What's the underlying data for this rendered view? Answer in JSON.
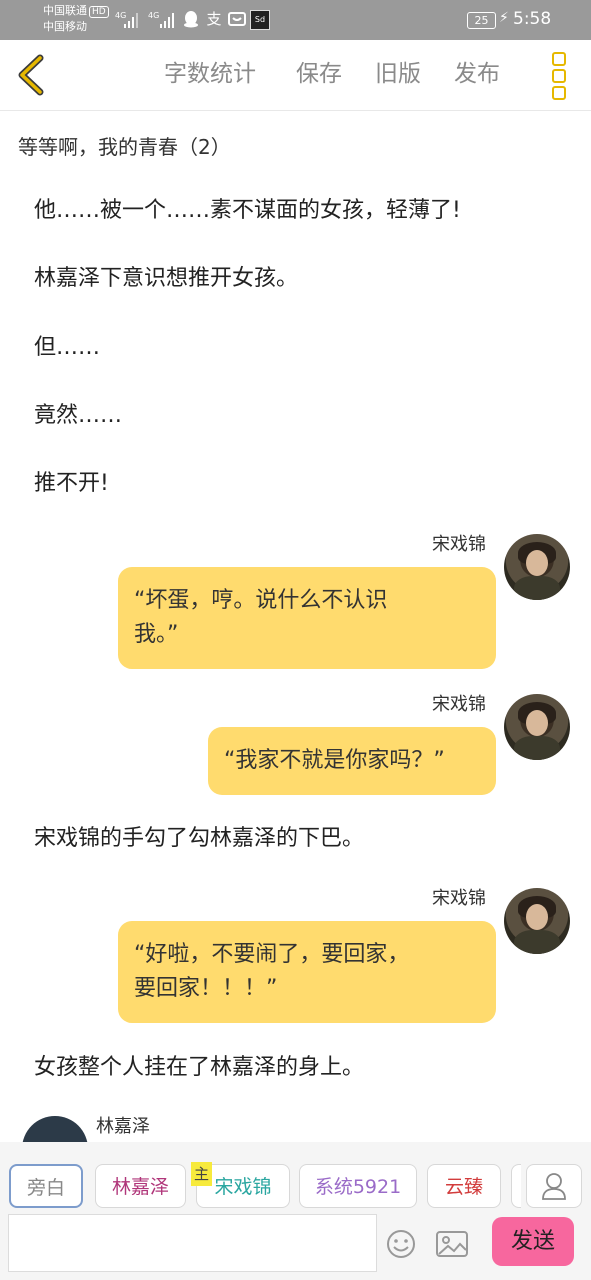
{
  "status_bar": {
    "carrier1": "中国联通",
    "hd": "HD",
    "carrier2": "中国移动",
    "net1": "4G",
    "net2": "4G",
    "battery": "25",
    "time": "5:58"
  },
  "toolbar": {
    "word_count": "字数统计",
    "save": "保存",
    "old_version": "旧版",
    "publish": "发布"
  },
  "chapter_title": "等等啊，我的青春（2）",
  "content": {
    "narration1": "他……被一个……素不谋面的女孩，轻薄了!",
    "narration2": "林嘉泽下意识想推开女孩。",
    "narration3": "但……",
    "narration4": "竟然……",
    "narration5": "推不开!",
    "msg1_speaker": "宋戏锦",
    "msg1_line1": "“坏蛋，哼。说什么不认识",
    "msg1_line2": "我。”",
    "msg2_speaker": "宋戏锦",
    "msg2_text": "“我家不就是你家吗？”",
    "narration6": "宋戏锦的手勾了勾林嘉泽的下巴。",
    "msg3_speaker": "宋戏锦",
    "msg3_line1": "“好啦，不要闹了，要回家，",
    "msg3_line2": "要回家！！！”",
    "narration7": "女孩整个人挂在了林嘉泽的身上。",
    "msg4_speaker": "林嘉泽"
  },
  "bottom_bar": {
    "narrator": "旁白",
    "char1": "林嘉泽",
    "host_tag": "主",
    "char2": "宋戏锦",
    "char3": "系统5921",
    "char4": "云臻",
    "send": "发送"
  },
  "colors": {
    "bubble": "#ffdb6e",
    "accent": "#e6b800",
    "send": "#f7679e",
    "char1": "#b0367a",
    "char2": "#2aa6a0",
    "char3": "#9a6bc8",
    "char4": "#d23c3c"
  }
}
